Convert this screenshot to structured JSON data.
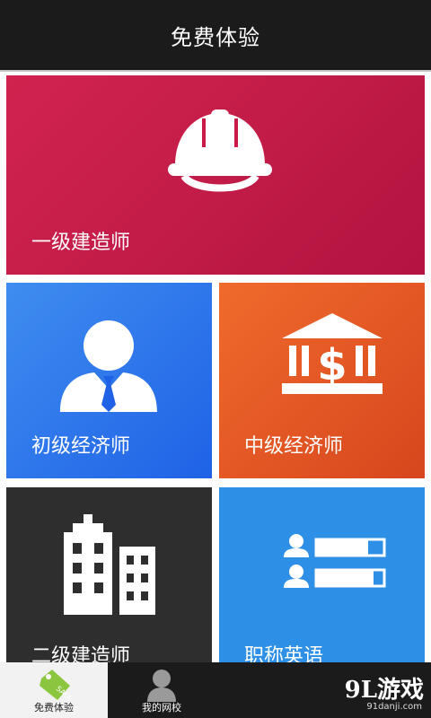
{
  "header": {
    "title": "免费体验"
  },
  "tiles": [
    {
      "label": "一级建造师",
      "icon": "hardhat-icon",
      "color": "#c91a48"
    },
    {
      "label": "初级经济师",
      "icon": "business-person-icon",
      "color": "#2f76ec"
    },
    {
      "label": "中级经济师",
      "icon": "bank-dollar-icon",
      "color": "#e85a25"
    },
    {
      "label": "二级建造师",
      "icon": "buildings-icon",
      "color": "#2e2e2e"
    },
    {
      "label": "职称英语",
      "icon": "user-progress-list-icon",
      "color": "#2e8fe6"
    }
  ],
  "bottom_nav": [
    {
      "label": "免费体验",
      "icon": "sale-tag-icon",
      "active": true
    },
    {
      "label": "我的网校",
      "icon": "user-avatar-icon",
      "active": false
    }
  ],
  "watermark": {
    "text": "9L游戏",
    "sub": "91danji.com"
  }
}
